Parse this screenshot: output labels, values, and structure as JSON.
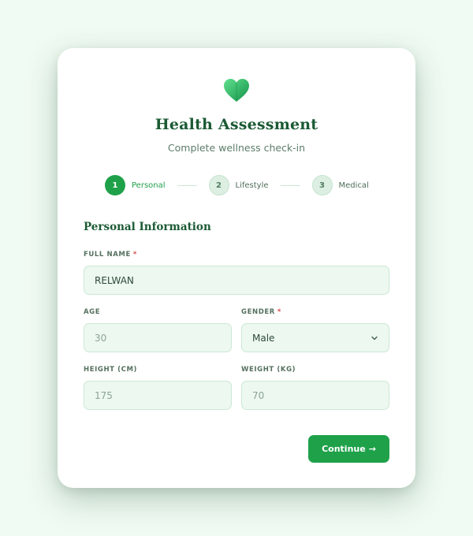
{
  "colors": {
    "page_bg": "#f0fbf3",
    "primary": "#1fa14a",
    "title": "#1b5a34",
    "field_bg": "#edf8f0",
    "required": "#d84b4b"
  },
  "header": {
    "logo_icon": "heart-icon",
    "title": "Health Assessment",
    "subtitle": "Complete wellness check-in"
  },
  "stepper": {
    "steps": [
      {
        "number": "1",
        "label": "Personal",
        "state": "active"
      },
      {
        "number": "2",
        "label": "Lifestyle",
        "state": "inactive"
      },
      {
        "number": "3",
        "label": "Medical",
        "state": "inactive"
      }
    ]
  },
  "form": {
    "section_title": "Personal Information",
    "full_name": {
      "label": "Full Name",
      "required_mark": "*",
      "value": "RELWAN"
    },
    "age": {
      "label": "Age",
      "value": "30"
    },
    "gender": {
      "label": "Gender",
      "required_mark": "*",
      "value": "Male",
      "icon": "chevron-down-icon"
    },
    "height": {
      "label": "Height (cm)",
      "value": "175"
    },
    "weight": {
      "label": "Weight (kg)",
      "value": "70"
    }
  },
  "actions": {
    "continue_label": "Continue",
    "continue_arrow": "→"
  }
}
